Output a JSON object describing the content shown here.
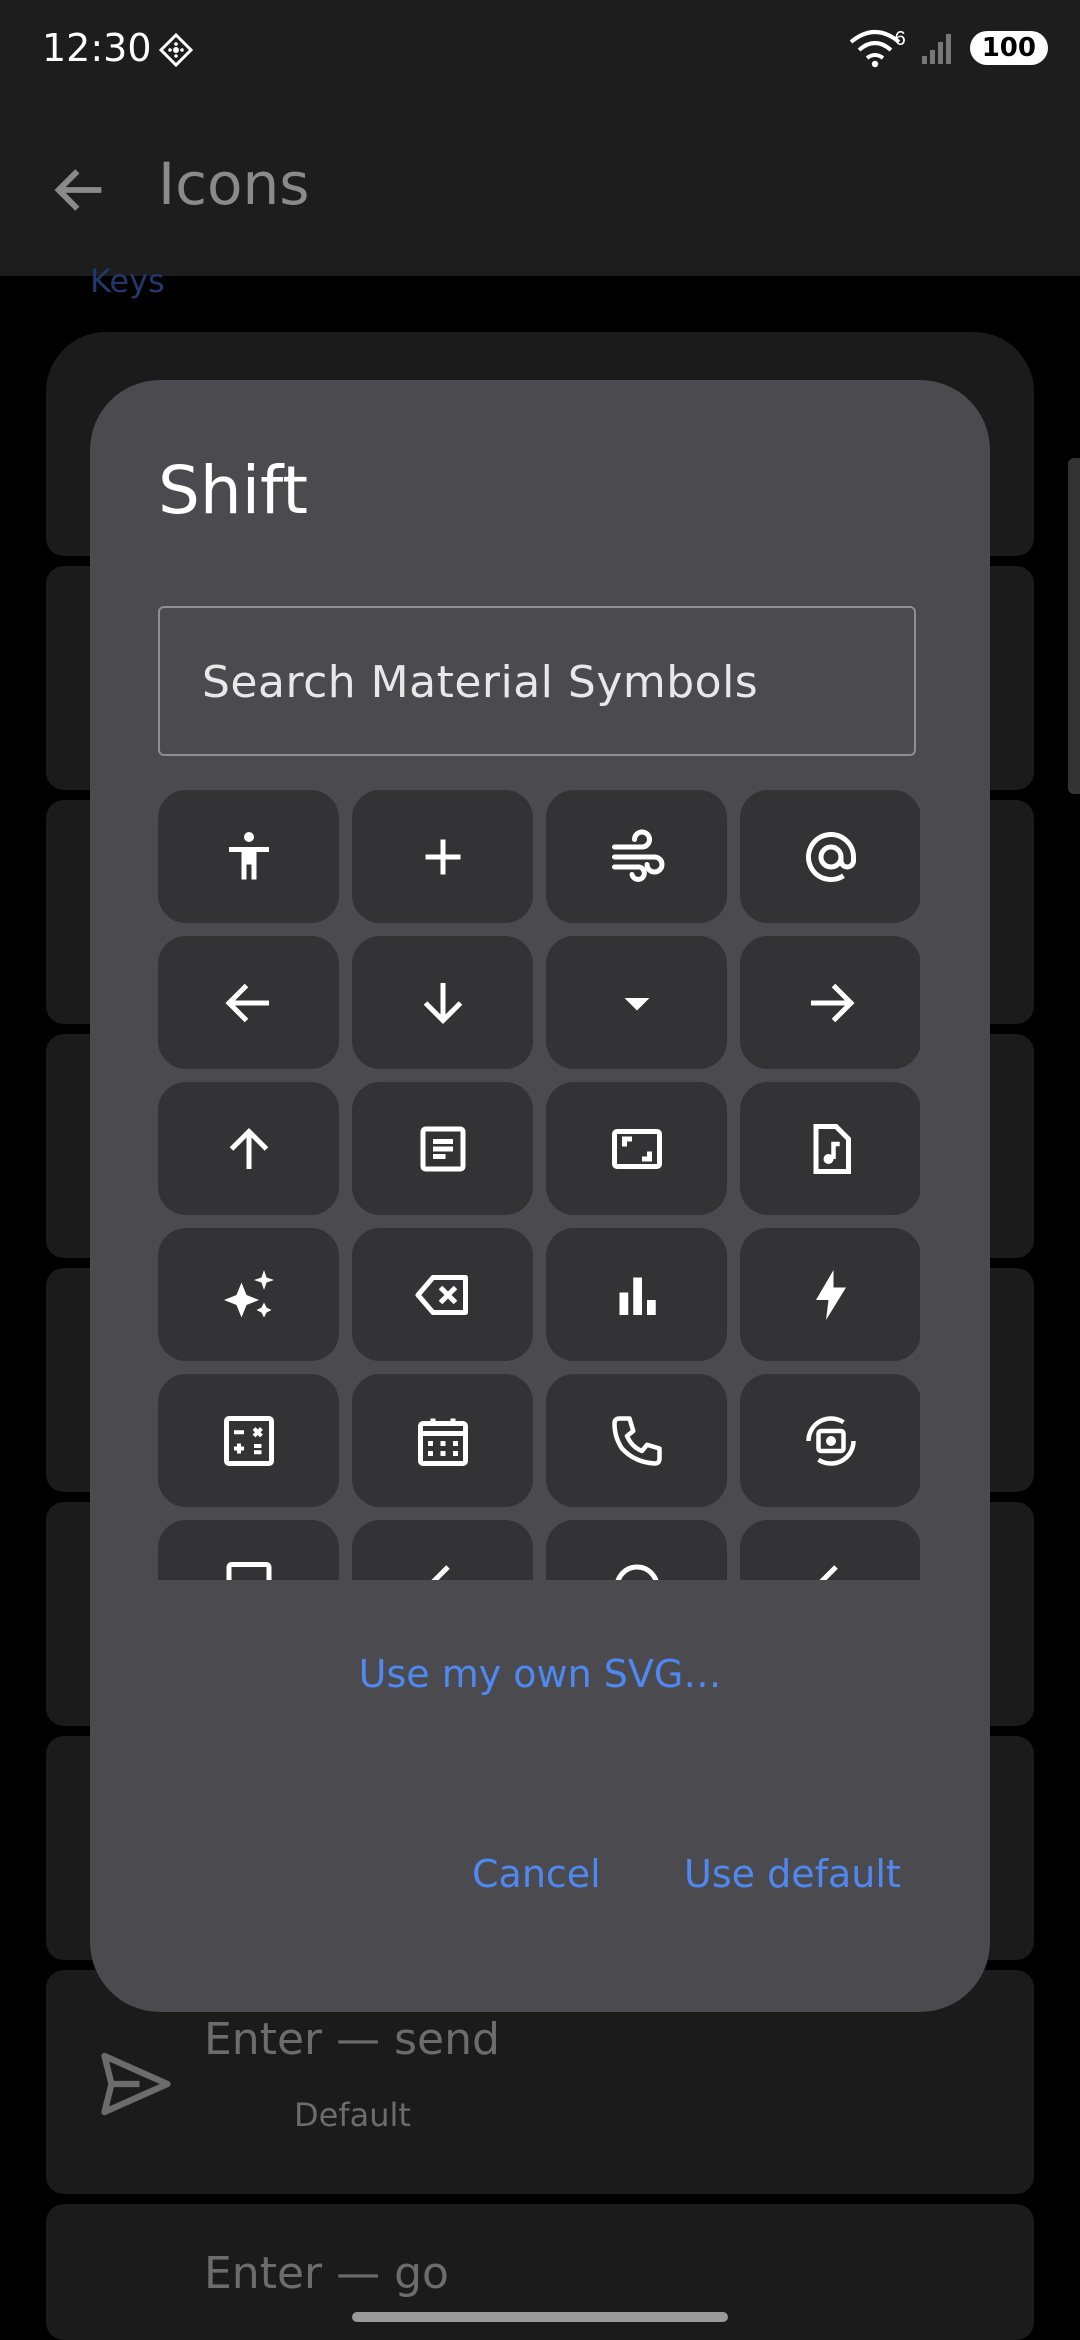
{
  "status_bar": {
    "time": "12:30",
    "wifi_badge": "6",
    "battery": "100"
  },
  "app_bar": {
    "title": "Icons",
    "back_icon": "arrow-back-icon"
  },
  "background": {
    "section_label": "Keys",
    "rows": [
      {
        "title": "Enter — send",
        "subtitle": "Default",
        "icon": "send-icon"
      },
      {
        "title": "Enter — go",
        "subtitle": "",
        "icon": "arrow-icon"
      }
    ]
  },
  "dialog": {
    "title": "Shift",
    "search_placeholder": "Search Material Symbols",
    "icons": [
      "accessibility-icon",
      "add-icon",
      "air-icon",
      "alternate-email-icon",
      "arrow-back-icon",
      "arrow-downward-icon",
      "arrow-drop-down-icon",
      "arrow-forward-icon",
      "arrow-upward-icon",
      "article-icon",
      "aspect-ratio-icon",
      "audio-file-icon",
      "auto-awesome-icon",
      "backspace-icon",
      "bar-chart-icon",
      "bolt-icon",
      "calculate-icon",
      "calendar-month-icon",
      "call-icon",
      "cameraswitch-icon",
      "partial-icon-1",
      "partial-icon-2",
      "partial-icon-3",
      "partial-icon-4"
    ],
    "own_svg_label": "Use my own SVG…",
    "cancel_label": "Cancel",
    "use_default_label": "Use default"
  },
  "colors": {
    "accent": "#4f88f0",
    "dialog_bg": "#4a4a4f",
    "cell_bg": "#333336"
  }
}
